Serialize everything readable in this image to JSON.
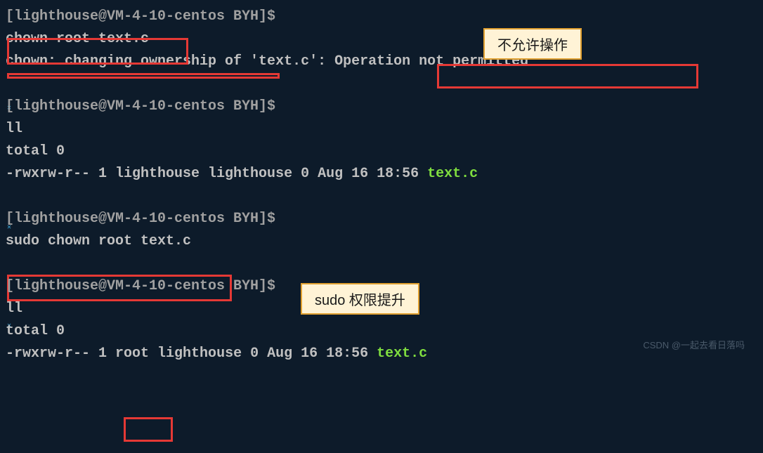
{
  "block1": {
    "prompt": "[lighthouse@VM-4-10-centos BYH]$",
    "cmd": "chown root text.c",
    "out_prefix": "chown: changing ownership of 'text.c': ",
    "out_error": "Operation not permitted",
    "annotation": "不允许操作"
  },
  "block2": {
    "prompt": "[lighthouse@VM-4-10-centos BYH]$",
    "cmd": "ll",
    "total": "total 0",
    "perm": "-rwxrw-r-- 1 lighthouse lighthouse 0 Aug 16 18:56 ",
    "file": "text.c"
  },
  "block3": {
    "prompt": "[lighthouse@VM-4-10-centos BYH]$",
    "cmd": "sudo chown root text.c",
    "annotation": "sudo 权限提升"
  },
  "block4": {
    "prompt": "[lighthouse@VM-4-10-centos BYH]$",
    "cmd": "ll",
    "total": "total 0",
    "perm_pre": "-rwxrw-r-- 1 ",
    "owner": "root",
    "perm_post": " lighthouse 0 Aug 16 18:56 ",
    "file": "text.c"
  },
  "watermark": "CSDN @一起去看日落吗"
}
